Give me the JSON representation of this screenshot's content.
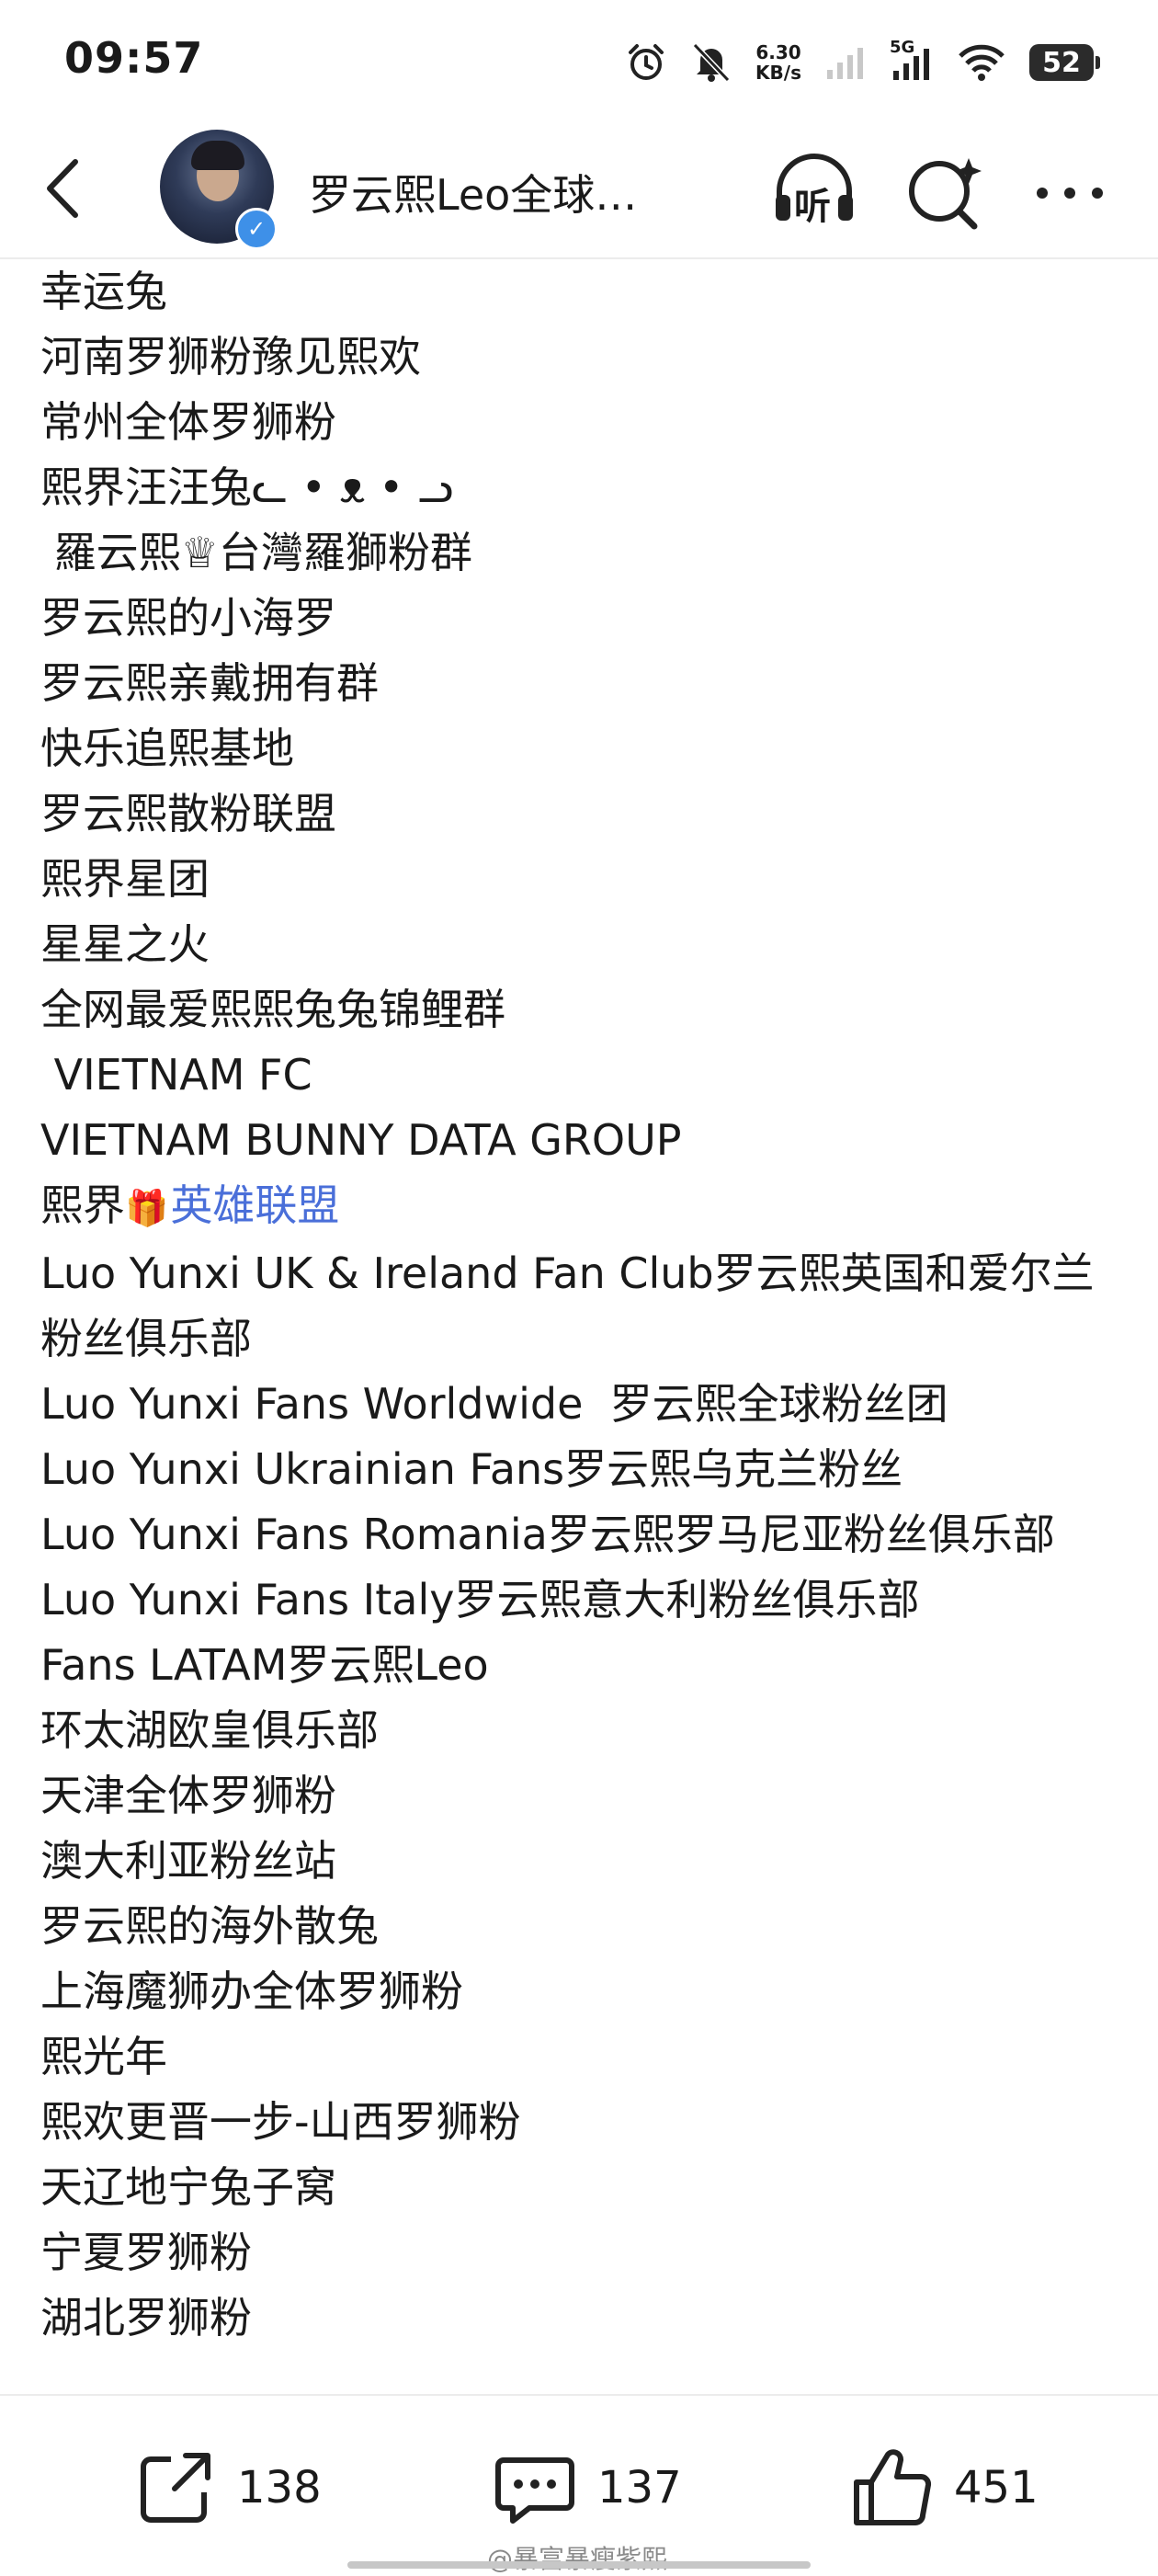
{
  "status_bar": {
    "time": "09:57",
    "speed_value": "6.30",
    "speed_unit": "KB/s",
    "network": "5G",
    "battery": "52"
  },
  "header": {
    "account_name": "罗云熙Leo全球…",
    "listen_label": "听",
    "icons": [
      "back-arrow-icon",
      "verified-icon",
      "headphone-icon",
      "search-icon",
      "more-icon"
    ]
  },
  "list": [
    "幸运兔",
    "河南罗狮粉豫见熙欢",
    "常州全体罗狮粉",
    "熙界汪汪兔ᓚ • ᴥ • ᓗ",
    " 羅云熙♕台灣羅獅粉群",
    "罗云熙的小海罗",
    "罗云熙亲戴拥有群",
    "快乐追熙基地",
    "罗云熙散粉联盟",
    "熙界星团",
    "星星之火",
    "全网最爱熙熙兔兔锦鲤群",
    " VIETNAM FC",
    "VIETNAM BUNNY DATA GROUP",
    "Luo Yunxi UK & Ireland Fan Club罗云熙英国和爱尔兰粉丝俱乐部",
    "Luo Yunxi Fans Worldwide  罗云熙全球粉丝团",
    "Luo Yunxi Ukrainian Fans罗云熙乌克兰粉丝",
    "Luo Yunxi Fans Romania罗云熙罗马尼亚粉丝俱乐部",
    "Luo Yunxi Fans Italy罗云熙意大利粉丝俱乐部",
    "Fans LATAM罗云熙Leo",
    "环太湖欧皇俱乐部",
    "天津全体罗狮粉",
    "澳大利亚粉丝站",
    "罗云熙的海外散兔",
    "上海魔狮办全体罗狮粉",
    "熙光年",
    "熙欢更晋一步-山西罗狮粉",
    "天辽地宁兔子窝",
    "宁夏罗狮粉",
    "湖北罗狮粉"
  ],
  "gift_item": {
    "prefix": "熙界",
    "link": "英雄联盟",
    "icon": "gift-icon"
  },
  "actions": {
    "share_count": "138",
    "comment_count": "137",
    "like_count": "451"
  },
  "watermark": "@暴富暴瘦紫熙",
  "colors": {
    "link": "#4a6fd9",
    "verified": "#3e90e8"
  }
}
